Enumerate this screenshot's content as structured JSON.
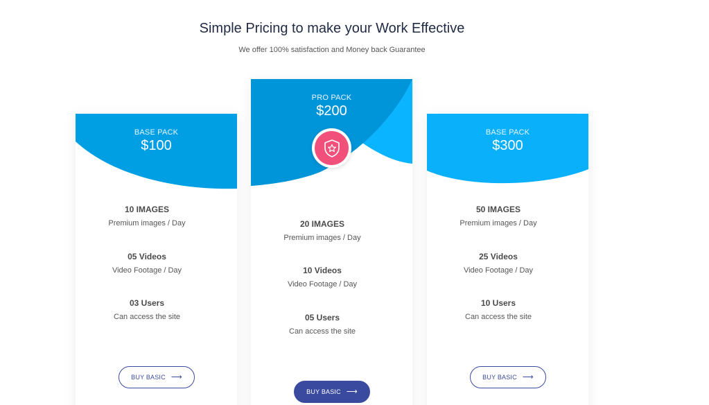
{
  "header": {
    "title": "Simple Pricing to make your Work Effective",
    "subtitle": "We offer 100% satisfaction and Money back Guarantee"
  },
  "colors": {
    "card1_head": "#009ee3",
    "card2_head_dark": "#0094d9",
    "card2_head_light": "#0bb4ff",
    "card3_head": "#0bb0fb",
    "badge": "#f0507a",
    "button": "#3a4a9f"
  },
  "plans": [
    {
      "name": "BASE PACK",
      "price": "$100",
      "features": [
        {
          "title": "10 IMAGES",
          "desc": "Premium images / Day"
        },
        {
          "title": "05 Videos",
          "desc": "Video Footage / Day"
        },
        {
          "title": "03 Users",
          "desc": "Can access the site"
        }
      ],
      "button": "BUY BASIC",
      "button_icon": "arrow-right-icon"
    },
    {
      "name": "PRO PACK",
      "price": "$200",
      "badge_icon": "shield-star-icon",
      "features": [
        {
          "title": "20 IMAGES",
          "desc": "Premium images / Day"
        },
        {
          "title": "10 Videos",
          "desc": "Video Footage / Day"
        },
        {
          "title": "05 Users",
          "desc": "Can access the site"
        }
      ],
      "button": "BUY BASIC",
      "button_icon": "arrow-right-icon"
    },
    {
      "name": "BASE PACK",
      "price": "$300",
      "features": [
        {
          "title": "50 IMAGES",
          "desc": "Premium images / Day"
        },
        {
          "title": "25 Videos",
          "desc": "Video Footage / Day"
        },
        {
          "title": "10 Users",
          "desc": "Can access the site"
        }
      ],
      "button": "BUY BASIC",
      "button_icon": "arrow-right-icon"
    }
  ]
}
